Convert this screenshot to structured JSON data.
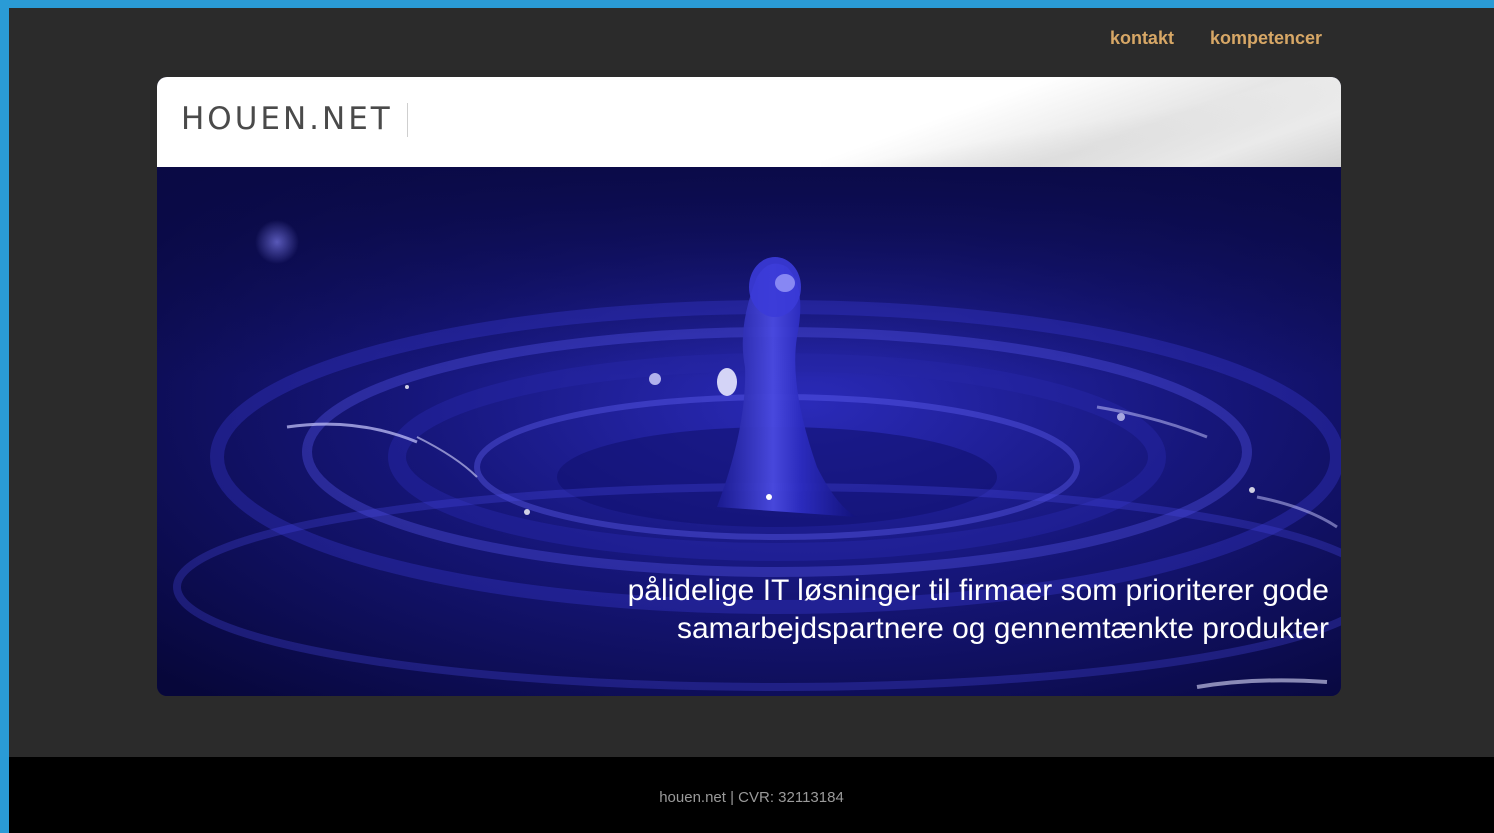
{
  "nav": {
    "items": [
      {
        "label": "kontakt"
      },
      {
        "label": "kompetencer"
      }
    ],
    "link_color": "#d7a766"
  },
  "brand": {
    "logo_text": "HOUEN.NET"
  },
  "hero": {
    "image": "water-drop-splash",
    "tagline_line1": "pålidelige IT løsninger til firmaer som prioriterer gode",
    "tagline_line2": "samarbejdspartnere og gennemtænkte produkter"
  },
  "footer": {
    "text": "houen.net | CVR: 32113184"
  },
  "colors": {
    "outer_border": "#2a9bd6",
    "page_bg": "#2b2b2b",
    "footer_bg": "#000000",
    "hero_blue": "#1a1a8c"
  }
}
